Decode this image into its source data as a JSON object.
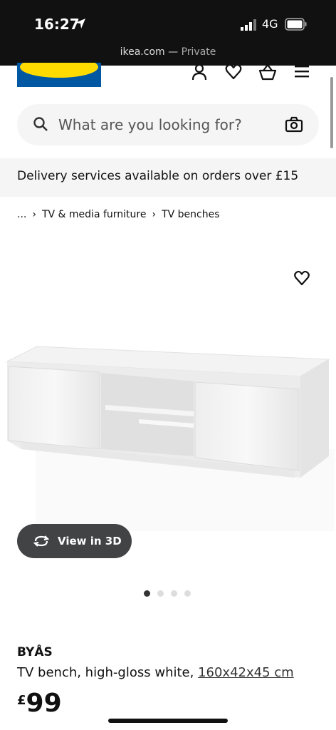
{
  "status": {
    "time": "16:27",
    "network": "4G"
  },
  "browser": {
    "domain": "ikea.com",
    "separator": " — ",
    "mode": "Private"
  },
  "header": {
    "logo_text": "IKEA"
  },
  "search": {
    "placeholder": "What are you looking for?"
  },
  "banner": {
    "text": "Delivery services available on orders over £15"
  },
  "breadcrumbs": {
    "ellipsis": "...",
    "items": [
      "TV & media furniture",
      "TV benches"
    ]
  },
  "product": {
    "name": "BYÅS",
    "description": "TV bench, high-gloss white, ",
    "dimensions": "160x42x45 cm",
    "currency": "£",
    "price": "99",
    "view3d_label": "View in 3D",
    "carousel": {
      "count": 4,
      "active": 1
    }
  },
  "colors": {
    "ikea_blue": "#0058a3",
    "ikea_yellow": "#ffdb00",
    "chip_bg": "#424345"
  }
}
